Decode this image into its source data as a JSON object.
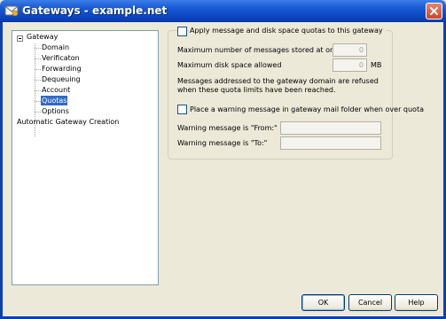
{
  "window": {
    "title": "Gateways - example.net",
    "app_icon": "gateway-app-icon",
    "close_icon": "close-icon"
  },
  "tree": {
    "root": {
      "label": "Gateway",
      "expander": "minus"
    },
    "children": [
      {
        "label": "Domain",
        "selected": false
      },
      {
        "label": "Verificaton",
        "selected": false
      },
      {
        "label": "Forwarding",
        "selected": false
      },
      {
        "label": "Dequeuing",
        "selected": false
      },
      {
        "label": "Account",
        "selected": false
      },
      {
        "label": "Quotas",
        "selected": true
      },
      {
        "label": "Options",
        "selected": false
      }
    ],
    "second_root": {
      "label": "Automatic Gateway Creation"
    }
  },
  "quotas": {
    "apply_checkbox_label": "Apply message and disk space quotas to this gateway",
    "apply_checked": false,
    "max_messages_label": "Maximum number of messages stored at once",
    "max_messages_value": "0",
    "max_disk_label": "Maximum disk space allowed",
    "max_disk_value": "0",
    "max_disk_unit": "MB",
    "refuse_note": "Messages addressed to the gateway domain are refused when these quota limits have been reached.",
    "warning_checkbox_label": "Place a warning message in gateway mail folder when over quota",
    "warning_checked": false,
    "warning_from_label": "Warning message is \"From:\"",
    "warning_from_value": "",
    "warning_to_label": "Warning message is \"To:\"",
    "warning_to_value": ""
  },
  "buttons": {
    "ok": "OK",
    "cancel": "Cancel",
    "help": "Help"
  }
}
